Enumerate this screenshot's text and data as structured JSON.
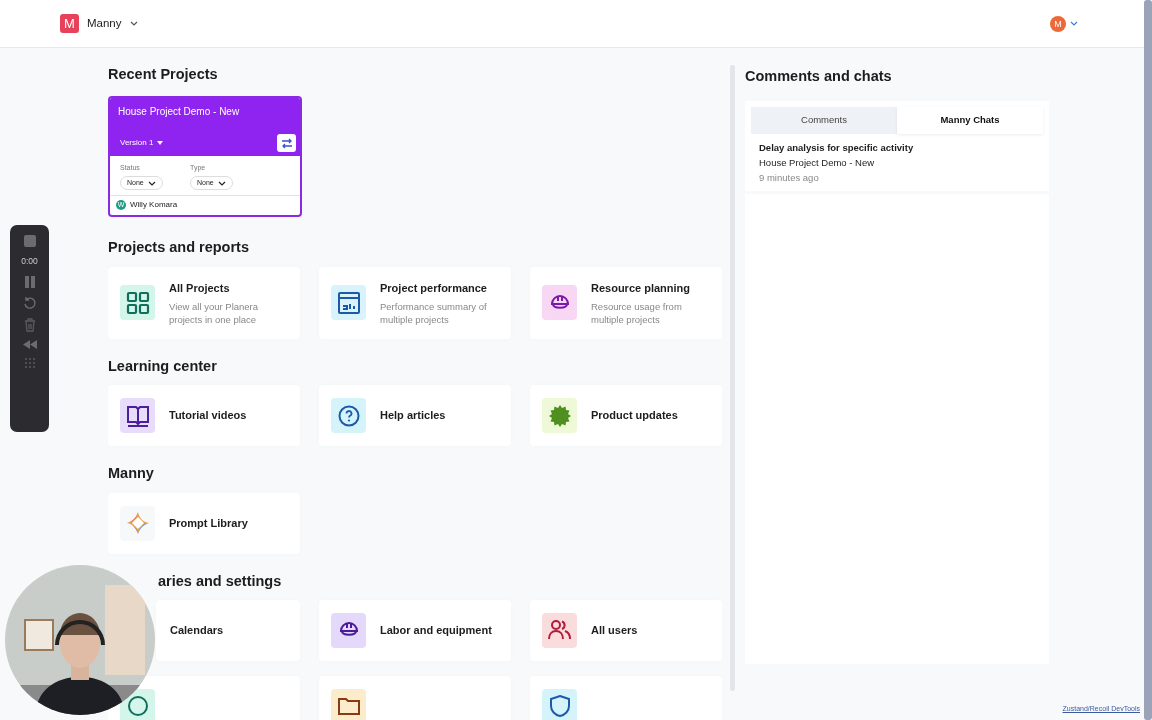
{
  "header": {
    "logo_letter": "M",
    "workspace": "Manny",
    "avatar_letter": "M"
  },
  "recorder": {
    "time": "0:00"
  },
  "recent": {
    "title": "Recent Projects",
    "projects": [
      {
        "name": "House Project Demo - New",
        "version": "Version 1",
        "status_label": "Status",
        "status_value": "None",
        "type_label": "Type",
        "type_value": "None",
        "owner_initial": "W",
        "owner": "Willy Komara"
      }
    ]
  },
  "sections": [
    {
      "title": "Projects and reports",
      "items": [
        {
          "kind": "grid",
          "title": "All Projects",
          "description": "View all your Planera projects in one place"
        },
        {
          "kind": "report",
          "title": "Project performance",
          "description": "Performance summary of multiple projects"
        },
        {
          "kind": "helmet-pink",
          "title": "Resource planning",
          "description": "Resource usage from multiple projects"
        }
      ]
    },
    {
      "title": "Learning center",
      "items": [
        {
          "kind": "book",
          "title": "Tutorial videos"
        },
        {
          "kind": "help",
          "title": "Help articles"
        },
        {
          "kind": "new",
          "title": "Product updates"
        }
      ]
    },
    {
      "title": "Manny",
      "items": [
        {
          "kind": "sparkle",
          "title": "Prompt Library"
        }
      ]
    },
    {
      "title": "aries and settings",
      "items": [
        {
          "kind": "calendar",
          "title": "Calendars"
        },
        {
          "kind": "helmet-violet",
          "title": "Labor and equipment"
        },
        {
          "kind": "users",
          "title": "All users"
        },
        {
          "kind": "green"
        },
        {
          "kind": "folder"
        },
        {
          "kind": "shield"
        }
      ]
    }
  ],
  "comments": {
    "title": "Comments and chats",
    "tabs": [
      {
        "label": "Comments",
        "selected": false
      },
      {
        "label": "Manny Chats",
        "selected": true
      }
    ],
    "chats": [
      {
        "title": "Delay analysis for specific activity",
        "project": "House Project Demo - New",
        "time": "9 minutes ago"
      }
    ]
  },
  "devtools_link": "Zustand/Recoil DevTools"
}
